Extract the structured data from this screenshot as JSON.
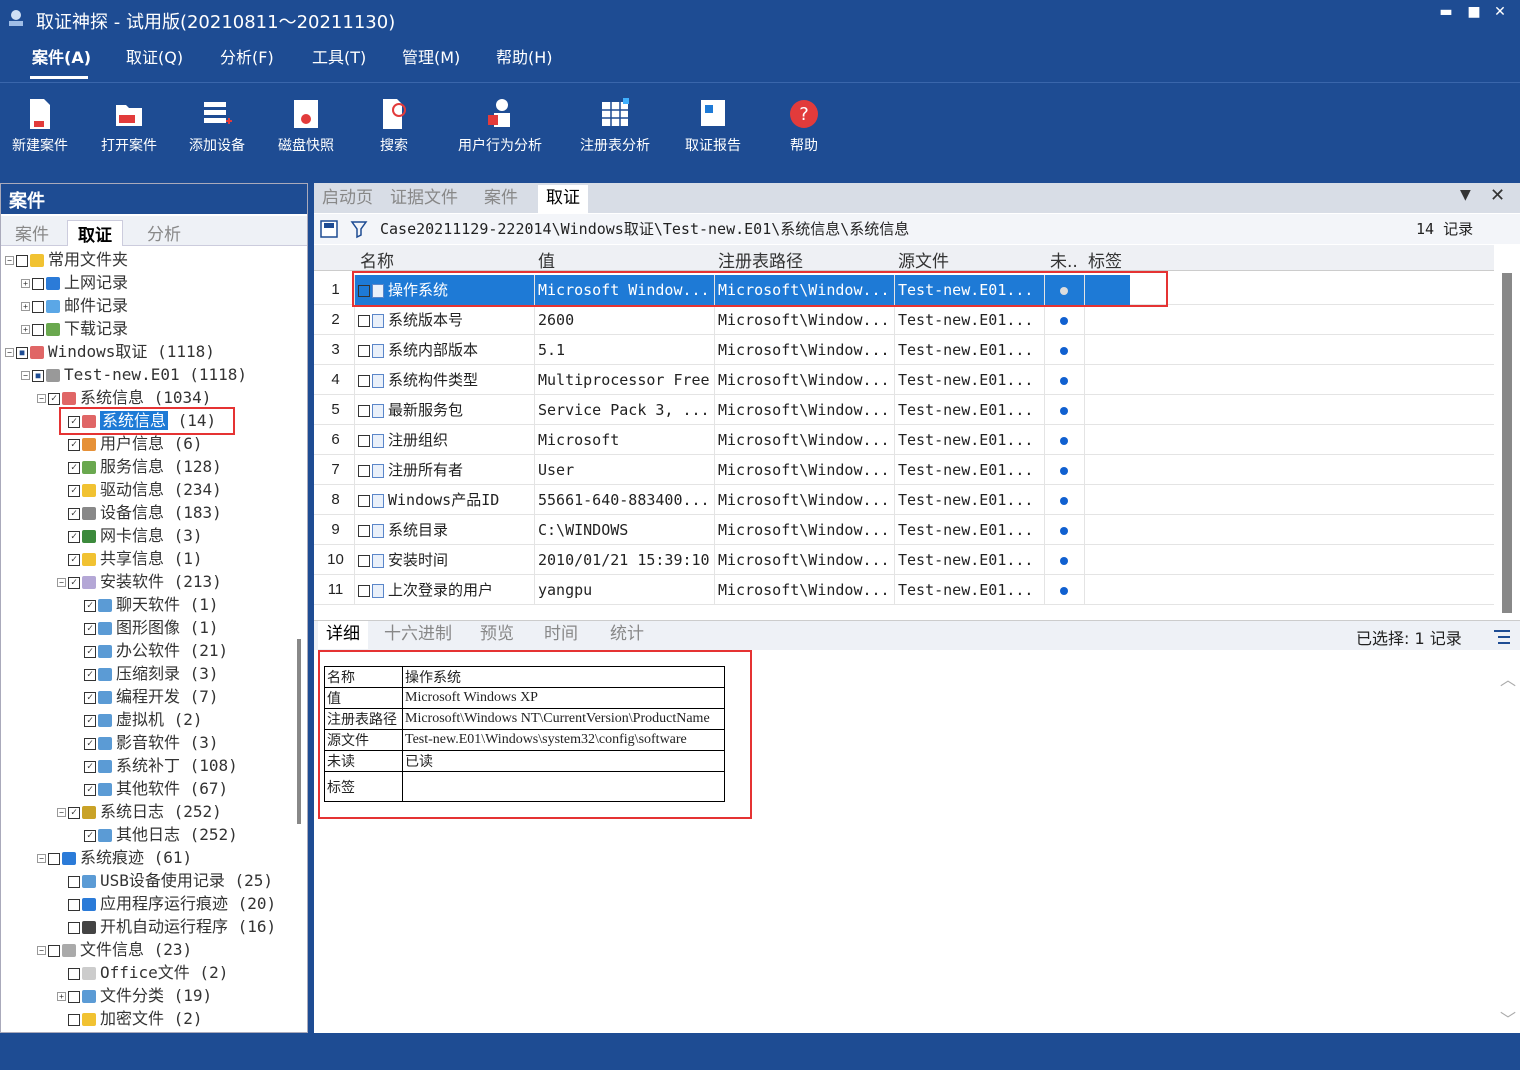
{
  "window": {
    "title": "取证神探 - 试用版(20210811～20211130)",
    "min": "▬",
    "max": "■",
    "close": "✕"
  },
  "menu": [
    "案件(A)",
    "取证(Q)",
    "分析(F)",
    "工具(T)",
    "管理(M)",
    "帮助(H)"
  ],
  "toolbar": [
    "新建案件",
    "打开案件",
    "添加设备",
    "磁盘快照",
    "搜索",
    "用户行为分析",
    "注册表分析",
    "取证报告",
    "帮助"
  ],
  "left_panel": {
    "header": "案件",
    "tabs": [
      "案件",
      "取证",
      "分析"
    ],
    "tree": [
      {
        "exp": "⊟",
        "cb": "",
        "label": "常用文件夹"
      },
      {
        "exp": "⊞",
        "cb": "",
        "label": "上网记录"
      },
      {
        "exp": "⊞",
        "cb": "",
        "label": "邮件记录"
      },
      {
        "exp": "⊞",
        "cb": "",
        "label": "下载记录"
      },
      {
        "exp": "⊟",
        "cb": "■",
        "label": "Windows取证 (1118)"
      },
      {
        "exp": "⊟",
        "cb": "■",
        "label": "Test-new.E01 (1118)"
      },
      {
        "exp": "⊟",
        "cb": "✓",
        "label": "系统信息 (1034)"
      },
      {
        "exp": "",
        "cb": "✓",
        "label": "系统信息",
        "count": "(14)"
      },
      {
        "exp": "",
        "cb": "✓",
        "label": "用户信息 (6)"
      },
      {
        "exp": "",
        "cb": "✓",
        "label": "服务信息 (128)"
      },
      {
        "exp": "",
        "cb": "✓",
        "label": "驱动信息 (234)"
      },
      {
        "exp": "",
        "cb": "✓",
        "label": "设备信息 (183)"
      },
      {
        "exp": "",
        "cb": "✓",
        "label": "网卡信息 (3)"
      },
      {
        "exp": "",
        "cb": "✓",
        "label": "共享信息 (1)"
      },
      {
        "exp": "⊟",
        "cb": "✓",
        "label": "安装软件 (213)"
      },
      {
        "exp": "",
        "cb": "✓",
        "label": "聊天软件 (1)"
      },
      {
        "exp": "",
        "cb": "✓",
        "label": "图形图像 (1)"
      },
      {
        "exp": "",
        "cb": "✓",
        "label": "办公软件 (21)"
      },
      {
        "exp": "",
        "cb": "✓",
        "label": "压缩刻录 (3)"
      },
      {
        "exp": "",
        "cb": "✓",
        "label": "编程开发 (7)"
      },
      {
        "exp": "",
        "cb": "✓",
        "label": "虚拟机 (2)"
      },
      {
        "exp": "",
        "cb": "✓",
        "label": "影音软件 (3)"
      },
      {
        "exp": "",
        "cb": "✓",
        "label": "系统补丁 (108)"
      },
      {
        "exp": "",
        "cb": "✓",
        "label": "其他软件 (67)"
      },
      {
        "exp": "⊟",
        "cb": "✓",
        "label": "系统日志 (252)"
      },
      {
        "exp": "",
        "cb": "✓",
        "label": "其他日志 (252)"
      },
      {
        "exp": "⊟",
        "cb": "",
        "label": "系统痕迹 (61)"
      },
      {
        "exp": "",
        "cb": "",
        "label": "USB设备使用记录 (25)"
      },
      {
        "exp": "",
        "cb": "",
        "label": "应用程序运行痕迹 (20)"
      },
      {
        "exp": "",
        "cb": "",
        "label": "开机自动运行程序 (16)"
      },
      {
        "exp": "⊟",
        "cb": "",
        "label": "文件信息 (23)"
      },
      {
        "exp": "",
        "cb": "",
        "label": "Office文件 (2)"
      },
      {
        "exp": "⊞",
        "cb": "",
        "label": "文件分类 (19)"
      },
      {
        "exp": "",
        "cb": "",
        "label": "加密文件 (2)"
      }
    ]
  },
  "right_panel": {
    "tabs": [
      "启动页",
      "证据文件",
      "案件",
      "取证"
    ],
    "tab_menu": "▼",
    "tab_close": "✕",
    "path": "Case20211129-222014\\Windows取证\\Test-new.E01\\系统信息\\系统信息",
    "record_count": "14 记录",
    "columns": [
      "名称",
      "值",
      "注册表路径",
      "源文件",
      "未..",
      "标签"
    ],
    "rows": [
      {
        "n": "1",
        "name": "操作系统",
        "value": "Microsoft Window...",
        "path": "Microsoft\\Window...",
        "src": "Test-new.E01..."
      },
      {
        "n": "2",
        "name": "系统版本号",
        "value": "2600",
        "path": "Microsoft\\Window...",
        "src": "Test-new.E01..."
      },
      {
        "n": "3",
        "name": "系统内部版本",
        "value": "5.1",
        "path": "Microsoft\\Window...",
        "src": "Test-new.E01..."
      },
      {
        "n": "4",
        "name": "系统构件类型",
        "value": "Multiprocessor Free",
        "path": "Microsoft\\Window...",
        "src": "Test-new.E01..."
      },
      {
        "n": "5",
        "name": "最新服务包",
        "value": "Service Pack 3, ...",
        "path": "Microsoft\\Window...",
        "src": "Test-new.E01..."
      },
      {
        "n": "6",
        "name": "注册组织",
        "value": "Microsoft",
        "path": "Microsoft\\Window...",
        "src": "Test-new.E01..."
      },
      {
        "n": "7",
        "name": "注册所有者",
        "value": "User",
        "path": "Microsoft\\Window...",
        "src": "Test-new.E01..."
      },
      {
        "n": "8",
        "name": "Windows产品ID",
        "value": "55661-640-883400...",
        "path": "Microsoft\\Window...",
        "src": "Test-new.E01..."
      },
      {
        "n": "9",
        "name": "系统目录",
        "value": "C:\\WINDOWS",
        "path": "Microsoft\\Window...",
        "src": "Test-new.E01..."
      },
      {
        "n": "10",
        "name": "安装时间",
        "value": "2010/01/21 15:39:10",
        "path": "Microsoft\\Window...",
        "src": "Test-new.E01..."
      },
      {
        "n": "11",
        "name": "上次登录的用户",
        "value": "yangpu",
        "path": "Microsoft\\Window...",
        "src": "Test-new.E01..."
      }
    ],
    "detail_tabs": [
      "详细",
      "十六进制",
      "预览",
      "时间",
      "统计"
    ],
    "selected_count": "已选择: 1 记录",
    "detail": [
      {
        "k": "名称",
        "v": "操作系统"
      },
      {
        "k": "值",
        "v": "Microsoft Windows XP"
      },
      {
        "k": "注册表路径",
        "v": "Microsoft\\Windows NT\\CurrentVersion\\ProductName"
      },
      {
        "k": "源文件",
        "v": "Test-new.E01\\Windows\\system32\\config\\software"
      },
      {
        "k": "未读",
        "v": "已读"
      },
      {
        "k": "标签",
        "v": ""
      }
    ]
  }
}
